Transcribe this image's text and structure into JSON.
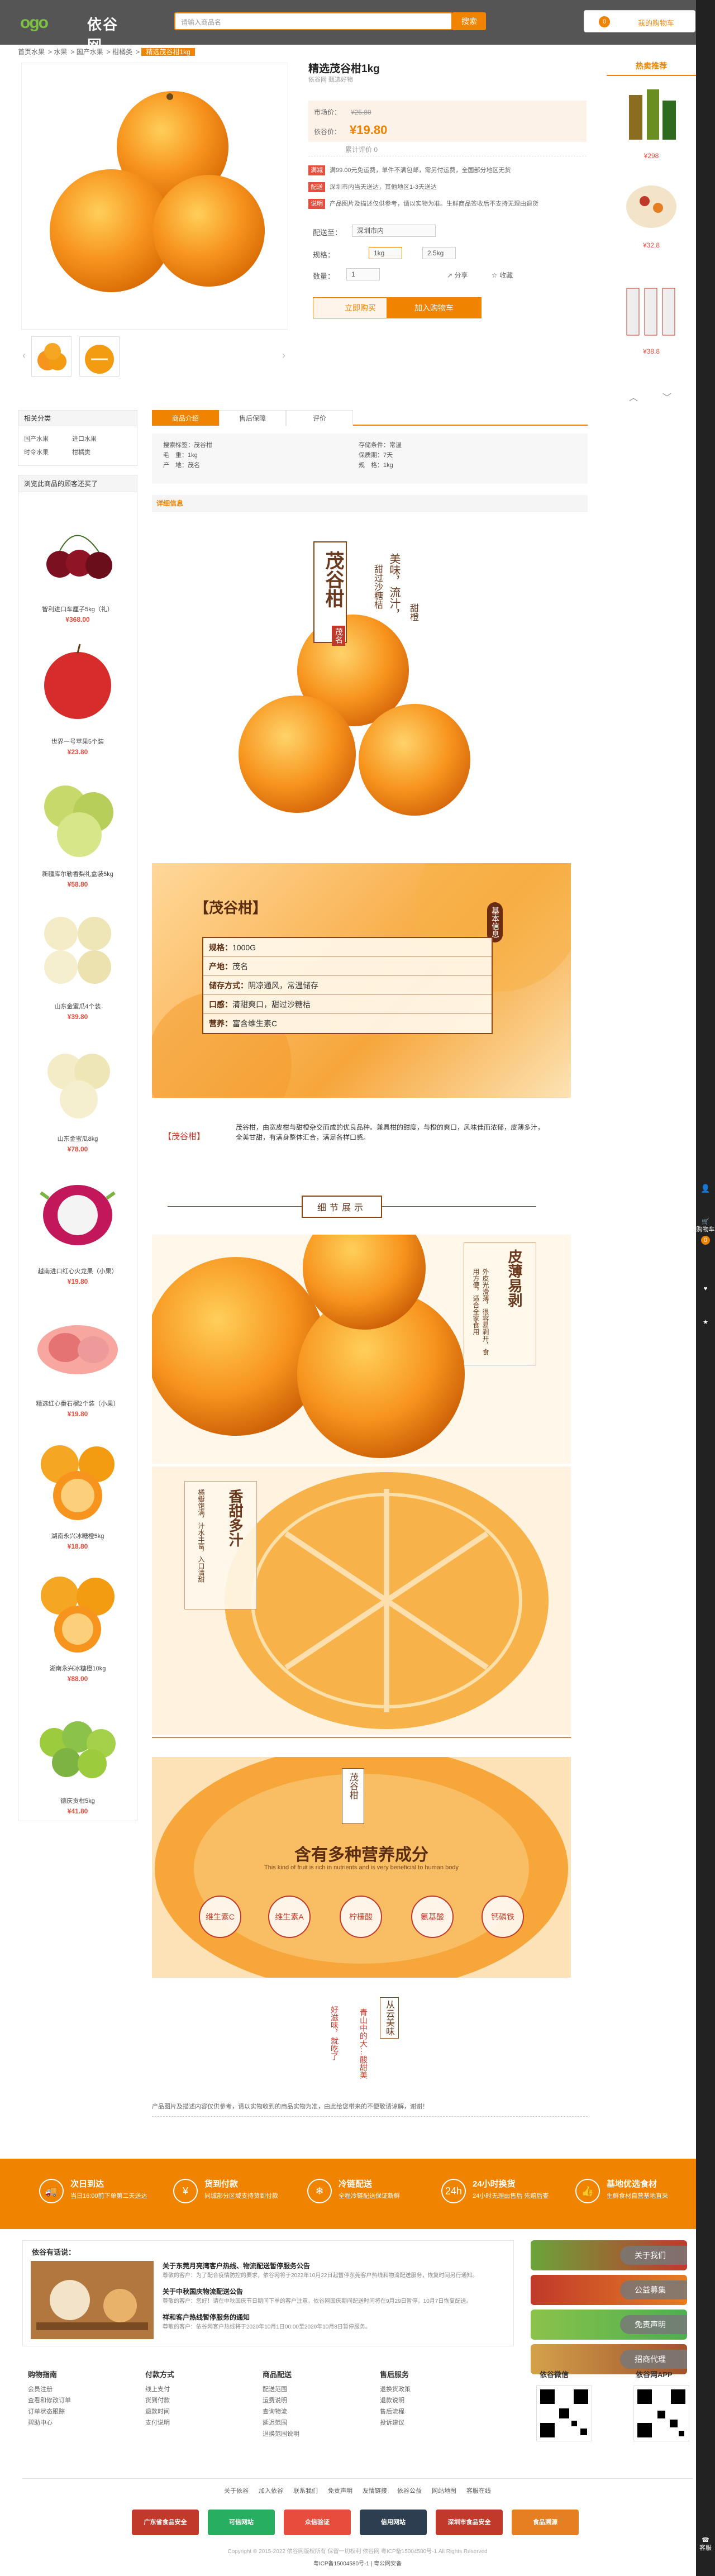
{
  "header": {
    "logo_mark": "ogo",
    "logo_name": "依谷网",
    "search_placeholder": "请输入商品名",
    "search_button": "搜索",
    "cart_count": "0",
    "cart_label": "我的购物车"
  },
  "breadcrumb": [
    "首页水果",
    "水果",
    "国产水果",
    "柑橘类",
    "精选茂谷柑1kg"
  ],
  "product": {
    "title": "精选茂谷柑1kg",
    "subtitle": "依谷网 甄选好物",
    "orig_label": "市场价：",
    "orig_price": "¥25.80",
    "price_label": "依谷价：",
    "price": "¥19.80",
    "comment": "累计评价 0",
    "promos": [
      {
        "tag": "满减",
        "text": "满99.00元免运费，单件不满包邮，需另付运费，全国部分地区无货"
      },
      {
        "tag": "配送",
        "text": "深圳市内当天送达，其他地区1-3天送达"
      },
      {
        "tag": "说明",
        "text": "产品图片及描述仅供参考，请以实物为准。生鲜商品签收后不支持无理由退货"
      }
    ],
    "delivery_label": "配送至：",
    "delivery_value": "深圳市内",
    "spec_label": "规格：",
    "specs": [
      "1kg",
      "2.5kg"
    ],
    "qty_label": "数量：",
    "qty": "1",
    "share": "分享",
    "fav": "收藏",
    "buy_now": "立即购买",
    "add_cart": "加入购物车"
  },
  "hot": {
    "title": "热卖推荐",
    "items": [
      {
        "price": "¥298"
      },
      {
        "price": "¥32.8"
      },
      {
        "price": "¥38.8"
      }
    ]
  },
  "related": {
    "title": "相关分类",
    "items": [
      "国产水果",
      "进口水果",
      "时令水果",
      "柑橘类"
    ]
  },
  "seen": {
    "title": "浏览此商品的顾客还买了",
    "items": [
      {
        "name": "智利进口车厘子5kg（礼）",
        "price": "¥368.00"
      },
      {
        "name": "世界一号苹果5个装",
        "price": "¥23.80"
      },
      {
        "name": "新疆库尔勒香梨礼盒装5kg",
        "price": "¥58.80"
      },
      {
        "name": "山东金蜜瓜4个装",
        "price": "¥39.80"
      },
      {
        "name": "山东金蜜瓜8kg",
        "price": "¥78.00"
      },
      {
        "name": "越南进口红心火龙果（小果）",
        "price": "¥19.80"
      },
      {
        "name": "精选红心番石榴2个装（小果）",
        "price": "¥19.80"
      },
      {
        "name": "湖南永兴冰糖橙5kg",
        "price": "¥18.80"
      },
      {
        "name": "湖南永兴冰糖橙10kg",
        "price": "¥88.00"
      },
      {
        "name": "德庆贡柑5kg",
        "price": "¥41.80"
      }
    ]
  },
  "tabs": [
    "商品介绍",
    "售后保障",
    "评价"
  ],
  "attrs": [
    {
      "k": "搜索标签：",
      "v": "茂谷柑"
    },
    {
      "k": "毛　重：",
      "v": "1kg"
    },
    {
      "k": "产　地：",
      "v": "茂名"
    },
    {
      "k": "存储条件：",
      "v": "常温"
    },
    {
      "k": "保质期：",
      "v": "7天"
    },
    {
      "k": "规　格：",
      "v": "1kg"
    }
  ],
  "detail_header": "详细信息",
  "detail": {
    "brand_vert": "茂谷柑",
    "brand_sub": "茂名",
    "slogan1": "美味，流汁，",
    "slogan2": "甜过沙糖桔",
    "slogan3": "甜橙",
    "info_title": "【茂谷柑】",
    "info_tag": "基本信息",
    "info_rows": [
      {
        "k": "规格：",
        "v": "1000G"
      },
      {
        "k": "产地：",
        "v": "茂名"
      },
      {
        "k": "储存方式：",
        "v": "阴凉通风，常温储存"
      },
      {
        "k": "口感：",
        "v": "清甜爽口，甜过沙糖桔"
      },
      {
        "k": "营养：",
        "v": "富含维生素C"
      }
    ],
    "intro_tag": "【茂谷柑】",
    "intro_text": "茂谷柑，由宽皮柑与甜橙杂交而成的优良品种。兼具柑的甜度，与橙的爽口，风味佳而浓郁，皮薄多汁，全美甘甜，有满身整体汇合，满足各样口感。",
    "detail_btn": "细节展示",
    "peel_title": "皮薄易剥",
    "peel_text": "外皮光滑薄，很容易剥开，食用方便，适合全家食用",
    "sweet_title": "香甜多汁",
    "sweet_text": "橘瓣饱满，汁水丰富，入口清甜",
    "nutri_tag": "茂谷柑",
    "nutri_title": "含有多种营养成分",
    "nutri_en": "This kind of fruit is rich in nutrients and is very beneficial to human body",
    "nutri": [
      "维生素C",
      "维生素A",
      "柠檬酸",
      "氨基酸",
      "钙磷铁"
    ],
    "poem1": "好滋味，就吃了",
    "poem2": "从云美味",
    "poem3": "青山中的大…酸甜美",
    "disclaimer": "产品图片及描述内容仅供参考，请以实物收到的商品实物为准，由此给您带来的不便敬请谅解，谢谢！"
  },
  "services": [
    {
      "icon": "🚚",
      "t1": "次日到达",
      "t2": "当日16:00前下单第二天送达"
    },
    {
      "icon": "¥",
      "t1": "货到付款",
      "t2": "同城部分区域支持货到付款"
    },
    {
      "icon": "❄",
      "t1": "冷链配送",
      "t2": "全程冷链配送保证新鲜"
    },
    {
      "icon": "24h",
      "t1": "24小时换货",
      "t2": "24小时无理由售后 先赔后查"
    },
    {
      "icon": "👍",
      "t1": "基地优选食材",
      "t2": "生鲜食材自营基地直采"
    }
  ],
  "news": {
    "title": "依谷有话说：",
    "items": [
      {
        "t": "关于东莞月亮湾客户热线、物流配送暂停服务公告",
        "d": "尊敬的客户：为了配合疫情防控的要求，依谷网将于2022年10月22日起暂停东莞客户热线和物流配送服务，恢复时间另行通知。"
      },
      {
        "t": "关于中秋国庆物流配送公告",
        "d": "尊敬的客户：您好！请在中秋国庆节日期间下单的客户注意，依谷网国庆期间配送时间将在9月29日暂停，10月7日恢复配送。"
      },
      {
        "t": "祥和客户热线暂停服务的通知",
        "d": "尊敬的客户：依谷网客户热线将于2020年10月1日00:00至2020年10月8日暂停服务。"
      }
    ]
  },
  "side_buttons": [
    "关于我们",
    "公益募集",
    "免责声明",
    "招商代理"
  ],
  "footer": {
    "cols": [
      {
        "h": "购物指南",
        "l": [
          "会员注册",
          "查看和修改订单",
          "订单状态跟踪",
          "帮助中心"
        ]
      },
      {
        "h": "付款方式",
        "l": [
          "线上支付",
          "货到付款",
          "退款时间",
          "支付说明"
        ]
      },
      {
        "h": "商品配送",
        "l": [
          "配送范围",
          "运费说明",
          "查询物流",
          "延迟范围",
          "退换范围说明"
        ]
      },
      {
        "h": "售后服务",
        "l": [
          "退换货政策",
          "退款说明",
          "售后流程",
          "投诉建议"
        ]
      }
    ],
    "qr1": "依谷微信",
    "qr2": "依谷网APP",
    "links": [
      "关于依谷",
      "加入依谷",
      "联系我们",
      "免责声明",
      "友情链接",
      "依谷公益",
      "网站地图",
      "客服在线"
    ],
    "badges": [
      "广东省食品安全",
      "可信网站",
      "众信验证",
      "信用网站",
      "深圳市食品安全",
      "食品溯源"
    ],
    "copyright": "Copyright © 2015-2022 依谷网版权所有 保留一切权利 依谷网 粤ICP备15004580号-1 All Rights Reserved",
    "icp": "粤ICP备15004580号-1 | 粤公网安备"
  },
  "rail": [
    "购物车",
    "收藏",
    "我的",
    "客服"
  ],
  "colors": {
    "accent": "#f08300",
    "price": "#e74c3c",
    "header": "#555555",
    "rail": "#222222"
  }
}
